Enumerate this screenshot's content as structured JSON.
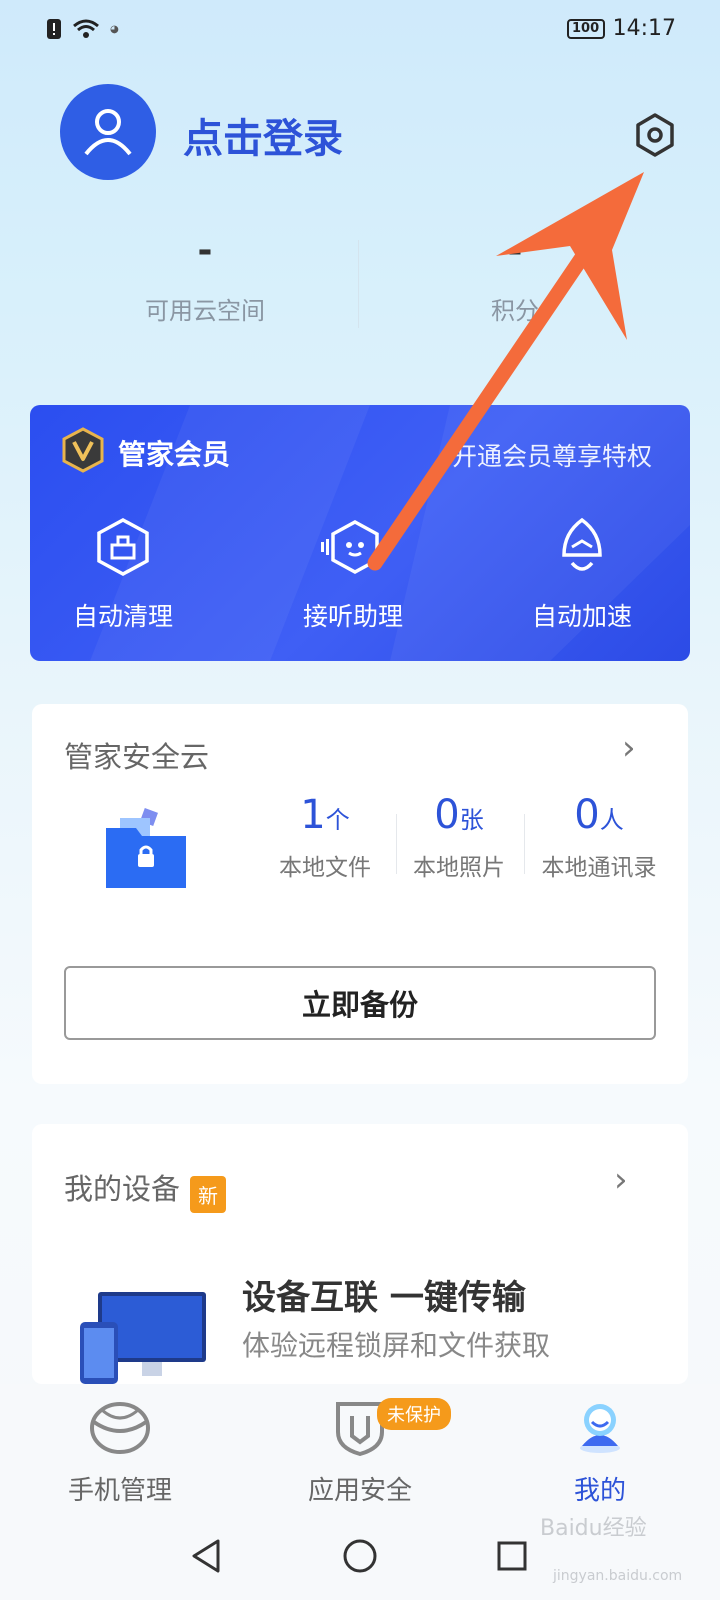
{
  "status_bar": {
    "time": "14:17",
    "battery": "100"
  },
  "header": {
    "login_label": "点击登录"
  },
  "stats": [
    {
      "value": "-",
      "label": "可用云空间"
    },
    {
      "value": "-",
      "label": "积分"
    }
  ],
  "member": {
    "title": "管家会员",
    "link": "开通会员尊享特权",
    "items": [
      {
        "label": "自动清理",
        "icon": "cleanup-icon"
      },
      {
        "label": "接听助理",
        "icon": "call-assistant-icon"
      },
      {
        "label": "自动加速",
        "icon": "rocket-icon"
      }
    ]
  },
  "cloud": {
    "title": "管家安全云",
    "stats": [
      {
        "value": "1",
        "unit": "个",
        "label": "本地文件"
      },
      {
        "value": "0",
        "unit": "张",
        "label": "本地照片"
      },
      {
        "value": "0",
        "unit": "人",
        "label": "本地通讯录"
      }
    ],
    "backup_button": "立即备份"
  },
  "devices": {
    "title": "我的设备",
    "badge": "新",
    "promo_title": "设备互联 一键传输",
    "promo_sub": "体验远程锁屏和文件获取"
  },
  "bottom_nav": {
    "items": [
      {
        "label": "手机管理",
        "icon": "phone-manager-icon"
      },
      {
        "label": "应用安全",
        "icon": "shield-icon",
        "badge": "未保护"
      },
      {
        "label": "我的",
        "icon": "profile-icon",
        "active": true
      }
    ]
  },
  "watermark": {
    "text": "Baidu经验",
    "url": "jingyan.baidu.com"
  },
  "colors": {
    "accent": "#2d53d8",
    "card_blue": "#3355f0",
    "badge_orange": "#f59a1b",
    "arrow": "#f46b3b"
  }
}
